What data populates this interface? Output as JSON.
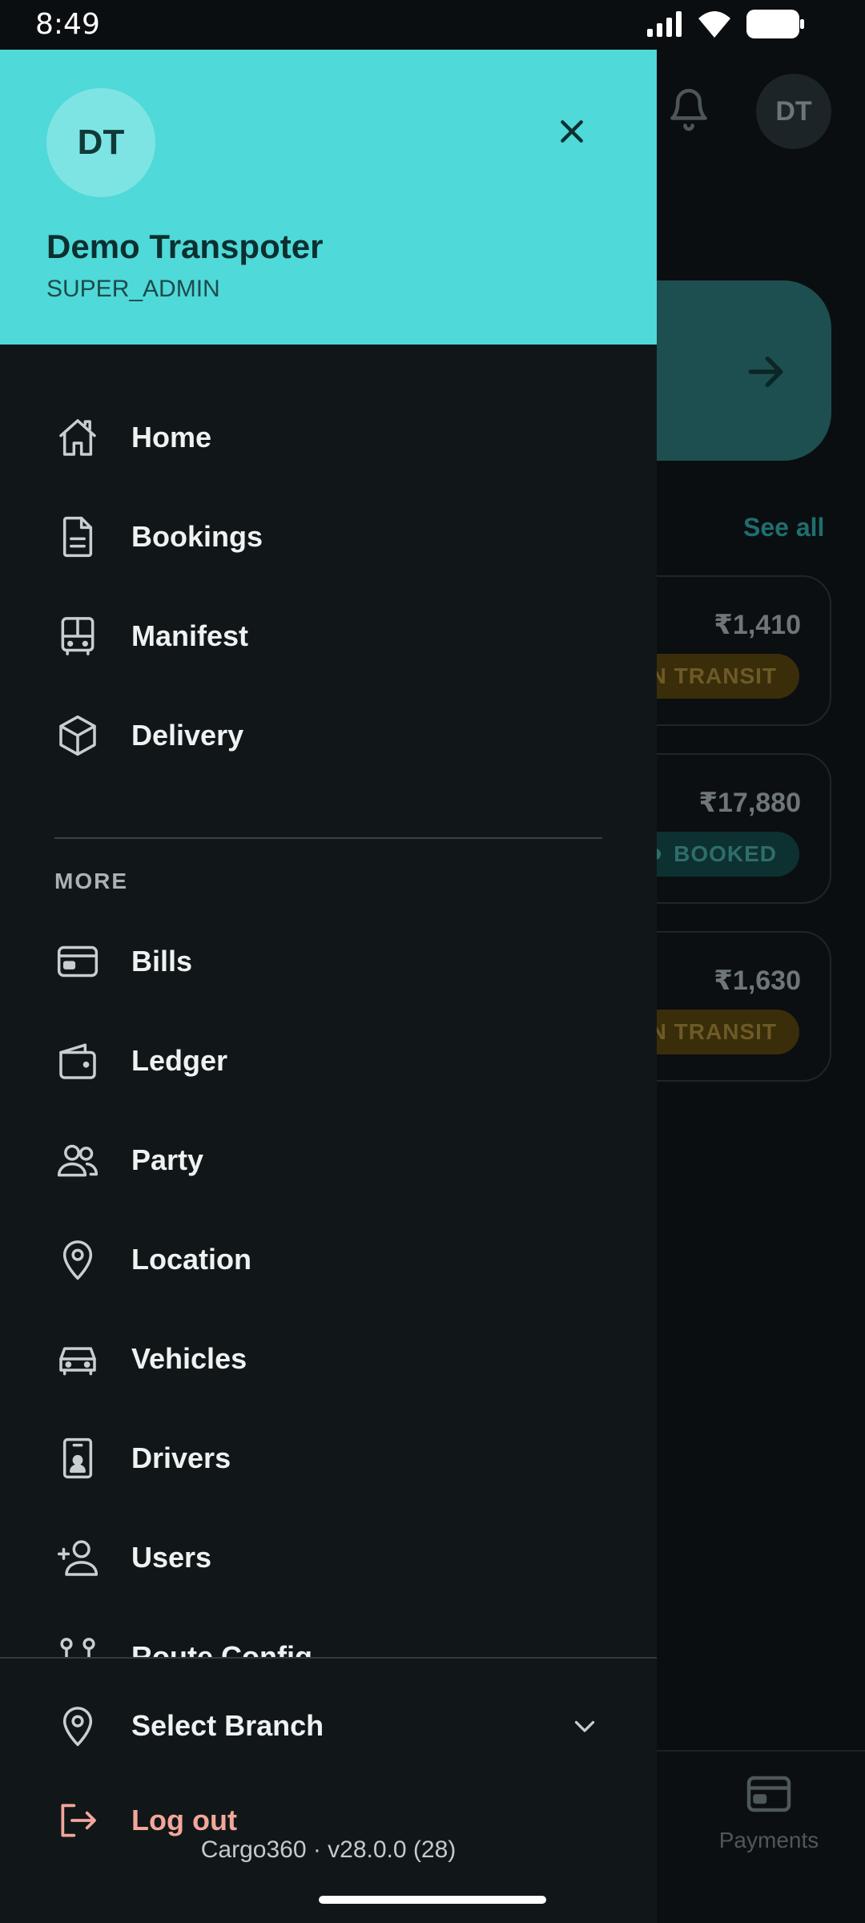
{
  "status_bar": {
    "time": "8:49"
  },
  "background": {
    "avatar_initials": "DT",
    "see_all": "See all",
    "cards": [
      {
        "amount": "₹1,410",
        "status": "N TRANSIT",
        "kind": "transit"
      },
      {
        "amount": "₹17,880",
        "status": "BOOKED",
        "kind": "booked"
      },
      {
        "amount": "₹1,630",
        "status": "N TRANSIT",
        "kind": "transit"
      }
    ],
    "bottom_nav": {
      "payments_label": "Payments"
    }
  },
  "drawer": {
    "avatar_initials": "DT",
    "user_name": "Demo Transpoter",
    "user_role": "SUPER_ADMIN",
    "primary_items": [
      {
        "label": "Home",
        "icon": "home-icon"
      },
      {
        "label": "Bookings",
        "icon": "document-icon"
      },
      {
        "label": "Manifest",
        "icon": "bus-icon"
      },
      {
        "label": "Delivery",
        "icon": "package-icon"
      }
    ],
    "more_label": "MORE",
    "more_items": [
      {
        "label": "Bills",
        "icon": "credit-card-icon"
      },
      {
        "label": "Ledger",
        "icon": "wallet-icon"
      },
      {
        "label": "Party",
        "icon": "users-icon"
      },
      {
        "label": "Location",
        "icon": "map-pin-icon"
      },
      {
        "label": "Vehicles",
        "icon": "car-icon"
      },
      {
        "label": "Drivers",
        "icon": "id-badge-icon"
      },
      {
        "label": "Users",
        "icon": "user-plus-icon"
      },
      {
        "label": "Route Config",
        "icon": "route-icon"
      }
    ],
    "footer": {
      "select_branch": "Select Branch",
      "logout": "Log out",
      "version": "Cargo360 · v28.0.0 (28)"
    },
    "colors": {
      "header_bg": "#4fd9d8",
      "drawer_bg": "#111719",
      "logout": "#f2a79a"
    }
  }
}
